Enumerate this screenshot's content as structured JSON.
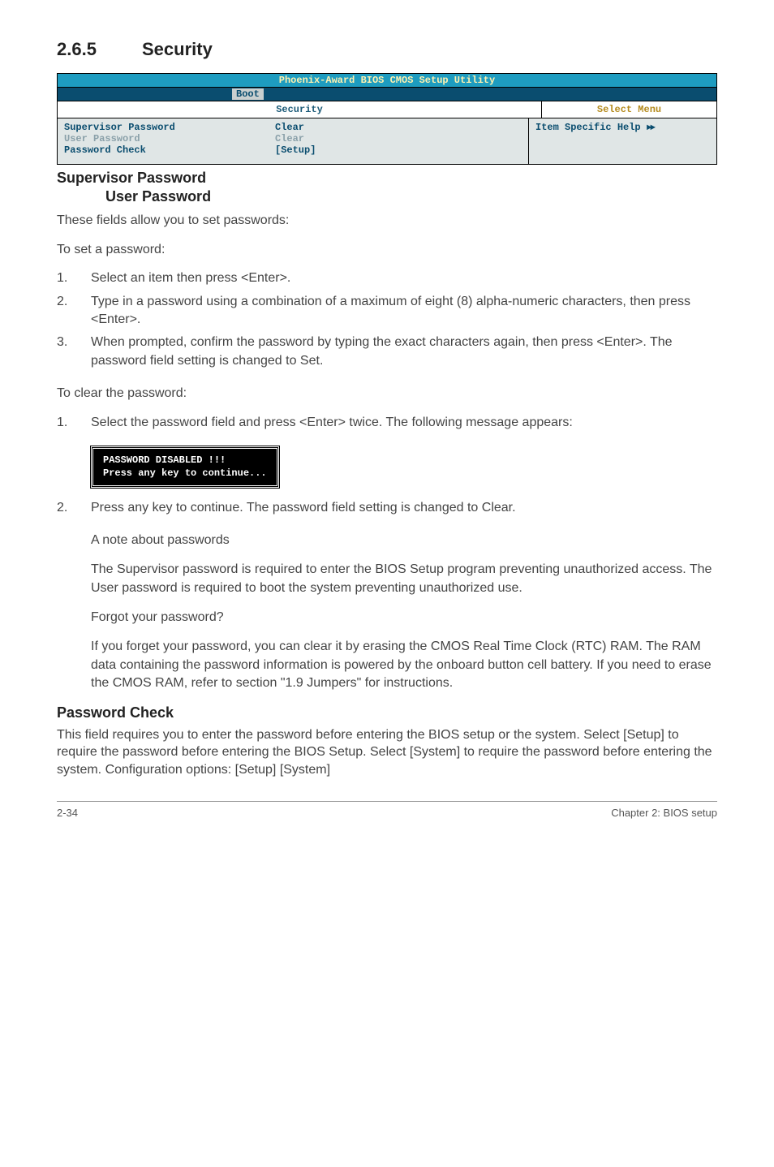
{
  "section": {
    "number": "2.6.5",
    "title": "Security"
  },
  "bios": {
    "title": "Phoenix-Award BIOS CMOS Setup Utility",
    "tab": "Boot",
    "header_left": "Security",
    "header_right": "Select Menu",
    "rows": [
      {
        "label": "Supervisor Password",
        "value": "Clear",
        "dim": false
      },
      {
        "label": "User Password",
        "value": "Clear",
        "dim": true
      },
      {
        "label": "Password Check",
        "value": "[Setup]",
        "dim": false
      }
    ],
    "help_label": "Item Specific Help",
    "help_arrows": "►►"
  },
  "sup_heading": "Supervisor Password",
  "user_heading": "User Password",
  "intro1": "These fields allow you to set passwords:",
  "intro2": "To set a password:",
  "set_steps": [
    "Select an item then press <Enter>.",
    "Type in a password using a combination of a maximum of eight (8) alpha-numeric characters, then press <Enter>.",
    "When prompted, confirm the password by typing the exact characters again, then press <Enter>. The password field setting is changed to Set."
  ],
  "clear_intro": "To clear the password:",
  "clear_step1": "Select the password field and press <Enter> twice. The following message appears:",
  "msg_line1": "PASSWORD DISABLED !!!",
  "msg_line2": "Press any key to continue...",
  "clear_step2": "Press any key to continue. The password field setting is changed to Clear.",
  "note": {
    "h1": "A note about passwords",
    "p1": "The Supervisor password is required to enter the BIOS Setup program preventing unauthorized access. The User password is required to boot the system preventing unauthorized use.",
    "h2": "Forgot your password?",
    "p2": "If you forget your password, you can clear it by erasing the CMOS Real Time Clock (RTC) RAM. The RAM data containing the password information is powered by the onboard button cell battery. If you need to erase the CMOS RAM, refer to section \"1.9 Jumpers\" for instructions."
  },
  "pwcheck": {
    "heading": "Password Check",
    "body": "This field requires you to enter the password before entering the BIOS setup or the system. Select [Setup] to require the password before entering the BIOS Setup. Select [System] to require the password before entering the system. Configuration options: [Setup] [System]"
  },
  "footer": {
    "left": "2-34",
    "right": "Chapter 2: BIOS setup"
  }
}
